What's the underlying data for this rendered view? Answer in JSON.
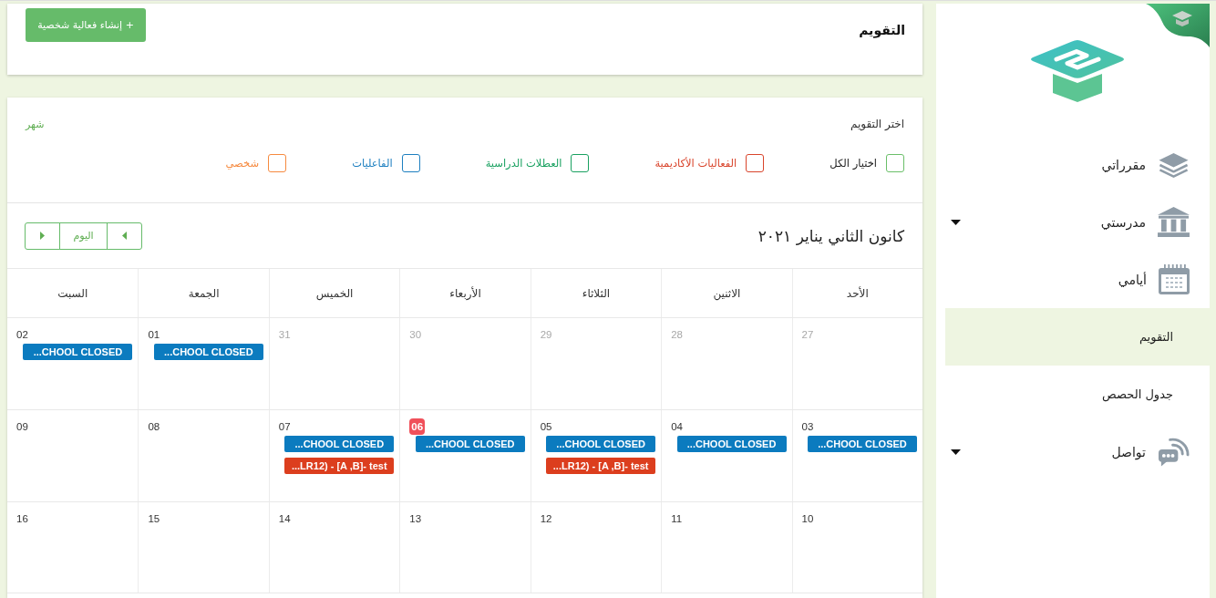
{
  "header": {
    "title": "التقويم",
    "create_button": "+ إنشاء فعالية شخصية"
  },
  "calendar_filter": {
    "title": "اختر التقويم",
    "view_link": "شهر",
    "options": [
      {
        "label": "اختيار الكل",
        "kind": "all",
        "color": "#6abf69",
        "checked": false
      },
      {
        "label": "الفعاليات الأكاديمية",
        "kind": "calendar",
        "color": "#d9442b",
        "checked": false
      },
      {
        "label": "العطلات الدراسية",
        "kind": "calendar",
        "color": "#19a160",
        "checked": false
      },
      {
        "label": "الفاعليات",
        "kind": "calendar",
        "color": "#1d7fc0",
        "checked": false
      },
      {
        "label": "شخصي",
        "kind": "calendar",
        "color": "#f68a3f",
        "checked": false
      }
    ]
  },
  "toolbar": {
    "month_title": "كانون الثاني يناير ٢٠٢١",
    "today_button": "اليوم"
  },
  "calendar": {
    "weekdays": [
      "الأحد",
      "الاثنين",
      "الثلاثاء",
      "الأربعاء",
      "الخميس",
      "الجمعة",
      "السبت"
    ],
    "weeks": [
      {
        "days": [
          {
            "day": "27",
            "other_month": true,
            "today": false
          },
          {
            "day": "28",
            "other_month": true,
            "today": false
          },
          {
            "day": "29",
            "other_month": true,
            "today": false
          },
          {
            "day": "30",
            "other_month": true,
            "today": false
          },
          {
            "day": "31",
            "other_month": true,
            "today": false
          },
          {
            "day": "01",
            "other_month": false,
            "today": false,
            "events": [
              {
                "title": "...CHOOL CLOSED",
                "color": "#0b7bbf"
              }
            ]
          },
          {
            "day": "02",
            "other_month": false,
            "today": false,
            "events": [
              {
                "title": "...CHOOL CLOSED",
                "color": "#0b7bbf"
              }
            ]
          }
        ]
      },
      {
        "days": [
          {
            "day": "03",
            "other_month": false,
            "today": false,
            "events": [
              {
                "title": "...CHOOL CLOSED",
                "color": "#0b7bbf"
              }
            ]
          },
          {
            "day": "04",
            "other_month": false,
            "today": false,
            "events": [
              {
                "title": "...CHOOL CLOSED",
                "color": "#0b7bbf"
              }
            ]
          },
          {
            "day": "05",
            "other_month": false,
            "today": false,
            "events": [
              {
                "title": "...CHOOL CLOSED",
                "color": "#0b7bbf"
              },
              {
                "title": "...LR12) - [A ,B]- test",
                "color": "#dc3e1e"
              }
            ]
          },
          {
            "day": "06",
            "other_month": false,
            "today": true,
            "events": [
              {
                "title": "...CHOOL CLOSED",
                "color": "#0b7bbf"
              }
            ]
          },
          {
            "day": "07",
            "other_month": false,
            "today": false,
            "events": [
              {
                "title": "...CHOOL CLOSED",
                "color": "#0b7bbf"
              },
              {
                "title": "...LR12) - [A ,B]- test",
                "color": "#dc3e1e"
              }
            ]
          },
          {
            "day": "08",
            "other_month": false,
            "today": false
          },
          {
            "day": "09",
            "other_month": false,
            "today": false
          }
        ]
      },
      {
        "days": [
          {
            "day": "10",
            "other_month": false,
            "today": false
          },
          {
            "day": "11",
            "other_month": false,
            "today": false
          },
          {
            "day": "12",
            "other_month": false,
            "today": false
          },
          {
            "day": "13",
            "other_month": false,
            "today": false
          },
          {
            "day": "14",
            "other_month": false,
            "today": false
          },
          {
            "day": "15",
            "other_month": false,
            "today": false
          },
          {
            "day": "16",
            "other_month": false,
            "today": false
          }
        ]
      }
    ]
  },
  "sidebar": {
    "items": [
      {
        "label": "مقرراتي",
        "kind": "link",
        "selected": false
      },
      {
        "label": "مدرستي",
        "kind": "dropdown",
        "expanded": false,
        "selected": false
      },
      {
        "label": "أيامي",
        "kind": "section",
        "expanded": true,
        "selected": false,
        "children": [
          {
            "label": "التقويم",
            "selected": true
          },
          {
            "label": "جدول الحصص",
            "selected": false
          }
        ]
      },
      {
        "label": "تواصل",
        "kind": "dropdown",
        "expanded": false,
        "selected": false
      }
    ]
  }
}
